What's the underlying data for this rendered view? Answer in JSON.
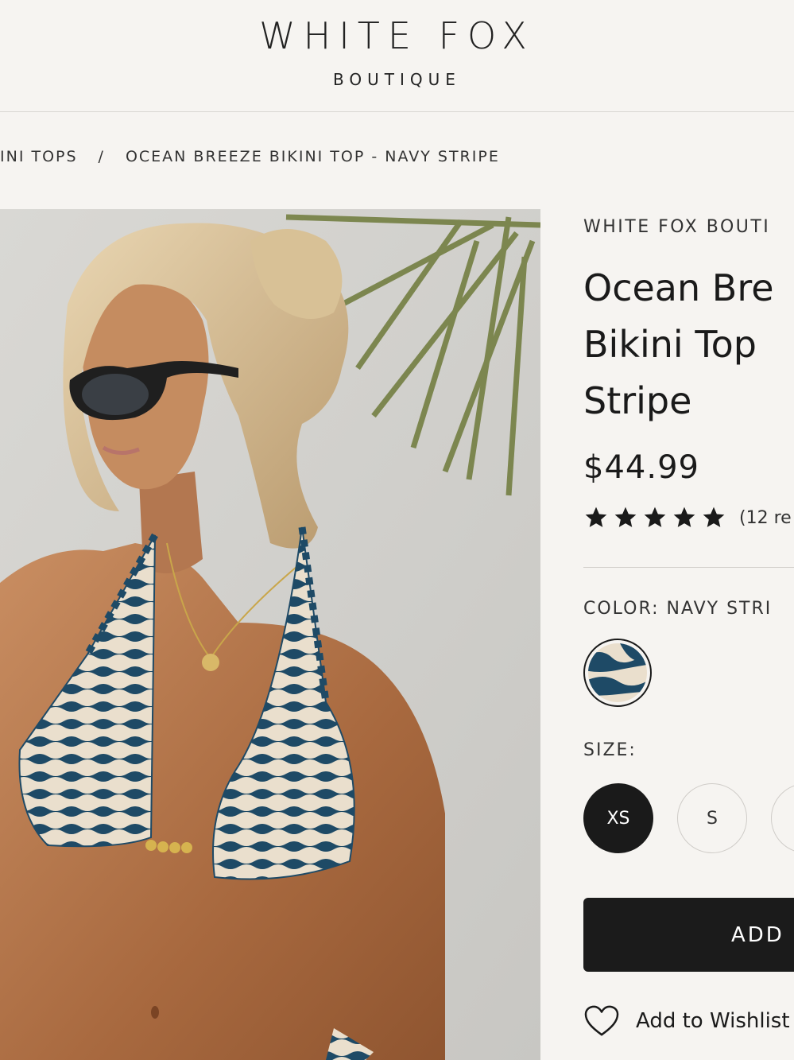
{
  "header": {
    "logo_main": "WHITE FOX",
    "logo_sub": "BOUTIQUE"
  },
  "breadcrumb": {
    "items": [
      "INI TOPS",
      "OCEAN BREEZE BIKINI TOP - NAVY STRIPE"
    ],
    "separator": "/"
  },
  "product": {
    "brand": "WHITE FOX BOUTI",
    "title_lines": [
      "Ocean Bre",
      "Bikini Top",
      "Stripe"
    ],
    "price": "$44.99",
    "rating": {
      "stars": 5,
      "max": 5,
      "reviews_text": "(12 re"
    },
    "color_label": "COLOR: NAVY STRI",
    "swatch_colors": {
      "navy": "#1e4a66",
      "cream": "#eadfcd"
    },
    "size_label": "SIZE:",
    "sizes": [
      "XS",
      "S",
      ""
    ],
    "selected_size": "XS",
    "add_button_label": "ADD",
    "wishlist_label": "Add to Wishlist"
  },
  "colors": {
    "background": "#f6f4f1",
    "button": "#1b1b1b",
    "text": "#1a1a1a"
  }
}
